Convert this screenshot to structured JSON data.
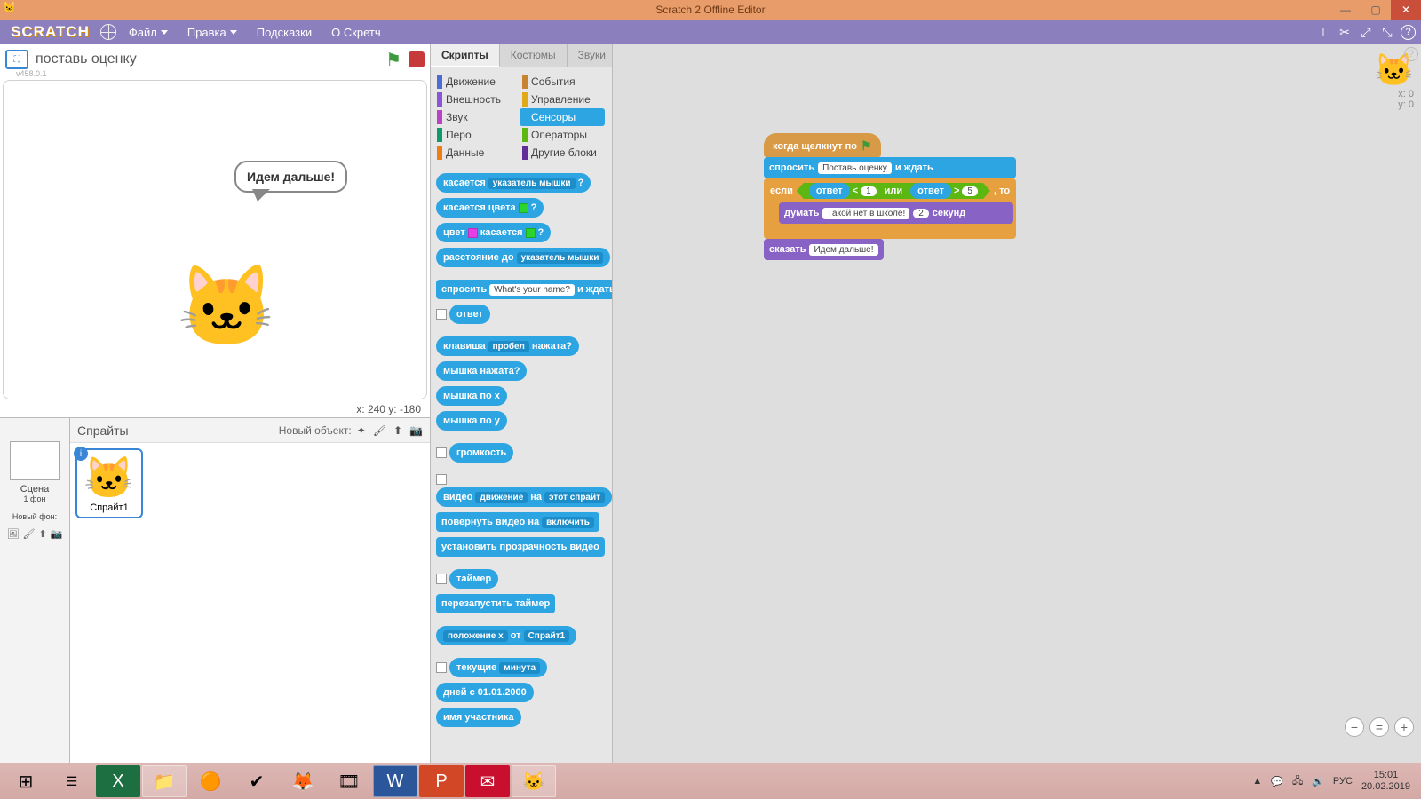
{
  "window": {
    "title": "Scratch 2 Offline Editor"
  },
  "menubar": {
    "logo": "SCRATCH",
    "file": "Файл",
    "edit": "Правка",
    "tips": "Подсказки",
    "about": "О Скретч"
  },
  "stage_header": {
    "project_title": "поставь оценку",
    "version": "v458.0.1"
  },
  "stage": {
    "speech": "Идем дальше!",
    "coords": "x: 240   y: -180"
  },
  "sprites": {
    "title": "Спрайты",
    "new_label": "Новый объект:",
    "stage_label": "Сцена",
    "stage_sub": "1 фон",
    "new_bg": "Новый фон:",
    "sprite1": "Спрайт1"
  },
  "tabs": {
    "scripts": "Скрипты",
    "costumes": "Костюмы",
    "sounds": "Звуки"
  },
  "categories": {
    "motion": "Движение",
    "looks": "Внешность",
    "sound": "Звук",
    "pen": "Перо",
    "data": "Данные",
    "events": "События",
    "control": "Управление",
    "sensing": "Сенсоры",
    "operators": "Операторы",
    "more": "Другие блоки"
  },
  "palette": {
    "touching": "касается",
    "touching_arg": "указатель мышки",
    "touching_color": "касается цвета",
    "color_is": "цвет",
    "touching2": "касается",
    "distance": "расстояние до",
    "distance_arg": "указатель мышки",
    "ask": "спросить",
    "ask_arg": "What's your name?",
    "ask_wait": "и ждать",
    "answer": "ответ",
    "key": "клавиша",
    "key_arg": "пробел",
    "key_pressed": "нажата?",
    "mouse_down": "мышка нажата?",
    "mouse_x": "мышка по x",
    "mouse_y": "мышка по y",
    "loudness": "громкость",
    "video": "видео",
    "video_arg1": "движение",
    "video_on": "на",
    "video_arg2": "этот спрайт",
    "turn_video": "повернуть видео на",
    "turn_video_arg": "включить",
    "video_trans": "установить прозрачность видео",
    "timer": "таймер",
    "reset_timer": "перезапустить таймер",
    "attr": "положение x",
    "attr_of": "от",
    "attr_arg": "Спрайт1",
    "current": "текущие",
    "current_arg": "минута",
    "days_since": "дней с 01.01.2000",
    "username": "имя участника",
    "q": "?"
  },
  "script_area": {
    "xy_x": "x: 0",
    "xy_y": "y: 0",
    "hat": "когда щелкнут по",
    "ask": "спросить",
    "ask_arg": "Поставь оценку",
    "ask_wait": "и ждать",
    "if": "если",
    "then": ", то",
    "answer": "ответ",
    "lt": "<",
    "lt_val": "1",
    "or": "или",
    "gt": ">",
    "gt_val": "5",
    "think": "думать",
    "think_arg": "Такой нет в школе!",
    "think_secs": "секунд",
    "think_n": "2",
    "say": "сказать",
    "say_arg": "Идем дальше!"
  },
  "taskbar": {
    "lang": "РУС",
    "time": "15:01",
    "date": "20.02.2019"
  }
}
